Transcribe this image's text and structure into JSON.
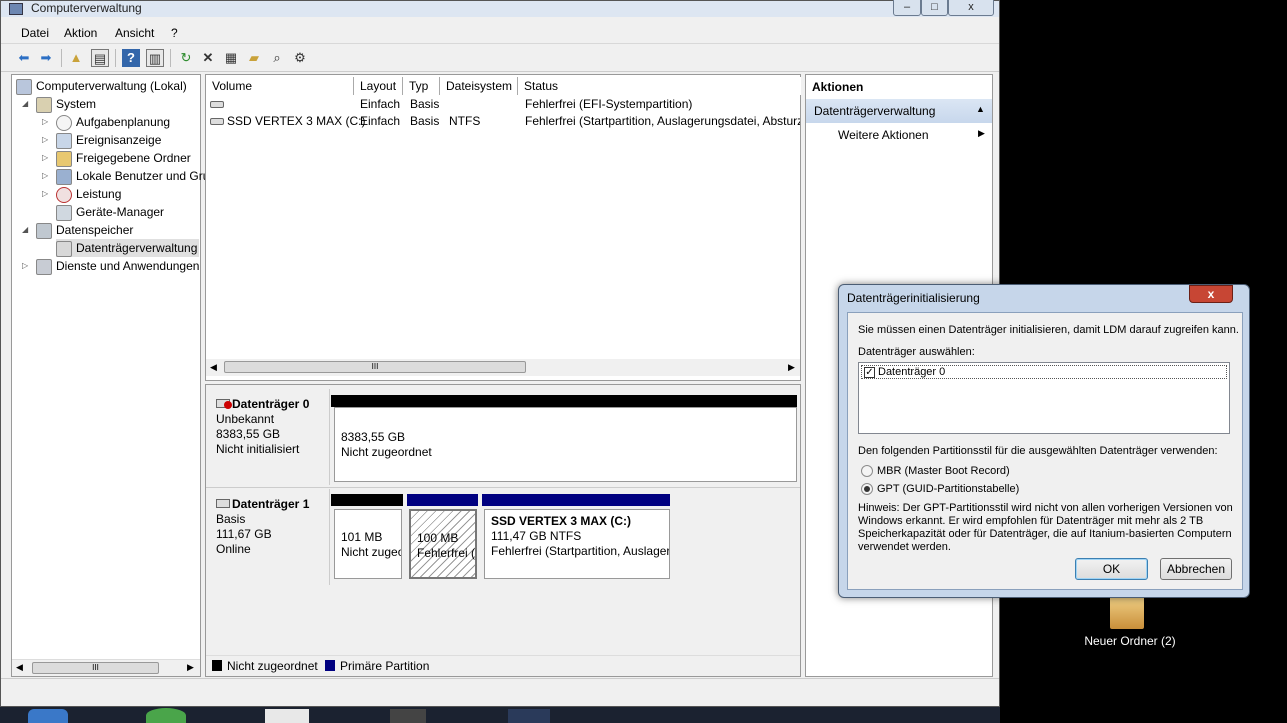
{
  "window": {
    "title": "Computerverwaltung",
    "min": "–",
    "max": "□",
    "close": "x"
  },
  "menu": [
    "Datei",
    "Aktion",
    "Ansicht",
    "?"
  ],
  "toolbar_icons": [
    "back-icon",
    "forward-icon",
    "up-folder-icon",
    "show-hide-tree-icon",
    "help-icon",
    "properties-pane-icon",
    "refresh-icon",
    "delete-icon",
    "properties-icon",
    "open-icon",
    "search-icon",
    "settings-icon"
  ],
  "tree": {
    "root": "Computerverwaltung (Lokal)",
    "items": [
      {
        "label": "System"
      },
      {
        "label": "Aufgabenplanung"
      },
      {
        "label": "Ereignisanzeige"
      },
      {
        "label": "Freigegebene Ordner"
      },
      {
        "label": "Lokale Benutzer und Gru"
      },
      {
        "label": "Leistung"
      },
      {
        "label": "Geräte-Manager"
      },
      {
        "label": "Datenspeicher"
      },
      {
        "label": "Datenträgerverwaltung"
      },
      {
        "label": "Dienste und Anwendungen"
      }
    ],
    "scroll_mid": "III"
  },
  "volumes": {
    "columns": [
      "Volume",
      "Layout",
      "Typ",
      "Dateisystem",
      "Status"
    ],
    "rows": [
      {
        "volume": "",
        "layout": "Einfach",
        "typ": "Basis",
        "fs": "",
        "status": "Fehlerfrei (EFI-Systempartition)"
      },
      {
        "volume": "SSD VERTEX 3 MAX (C:)",
        "layout": "Einfach",
        "typ": "Basis",
        "fs": "NTFS",
        "status": "Fehlerfrei (Startpartition, Auslagerungsdatei, Absturz"
      }
    ],
    "scroll_mid": "III"
  },
  "disks": [
    {
      "name": "Datenträger 0",
      "kind": "Unbekannt",
      "size": "8383,55 GB",
      "state": "Nicht initialisiert",
      "part": {
        "size": "8383,55 GB",
        "status": "Nicht zugeordnet"
      }
    },
    {
      "name": "Datenträger 1",
      "kind": "Basis",
      "size": "111,67 GB",
      "state": "Online",
      "parts": [
        {
          "size": "101 MB",
          "status": "Nicht zugeo"
        },
        {
          "size": "100 MB",
          "status": "Fehlerfrei (E"
        },
        {
          "title": "SSD VERTEX 3 MAX  (C:)",
          "size": "111,47 GB NTFS",
          "status": "Fehlerfrei (Startpartition, Auslager"
        }
      ]
    }
  ],
  "legend": {
    "unallocated": "Nicht zugeordnet",
    "primary": "Primäre Partition"
  },
  "actions": {
    "header": "Aktionen",
    "section": "Datenträgerverwaltung",
    "more": "Weitere Aktionen"
  },
  "dialog": {
    "title": "Datenträgerinitialisierung",
    "close": "x",
    "intro": "Sie müssen einen Datenträger initialisieren, damit LDM darauf zugreifen kann.",
    "select_label": "Datenträger auswählen:",
    "disk_item": "Datenträger 0",
    "style_label": "Den folgenden Partitionsstil für die ausgewählten Datenträger verwenden:",
    "mbr": "MBR (Master Boot Record)",
    "gpt": "GPT (GUID-Partitionstabelle)",
    "note_1": "Hinweis: Der GPT-Partitionsstil wird nicht von allen vorherigen Versionen von",
    "note_2": "Windows erkannt. Er wird empfohlen für Datenträger mit mehr als 2 TB",
    "note_3": "Speicherkapazität oder für Datenträger, die auf Itanium-basierten Computern",
    "note_4": "verwendet werden.",
    "ok": "OK",
    "cancel": "Abbrechen"
  },
  "desktop": {
    "folder_label": "Neuer Ordner (2)"
  },
  "colors": {
    "unallocated": "#000000",
    "primary": "#000080",
    "titlebar": "#dde6f2",
    "dialog_frame": "#c6d6ea"
  }
}
